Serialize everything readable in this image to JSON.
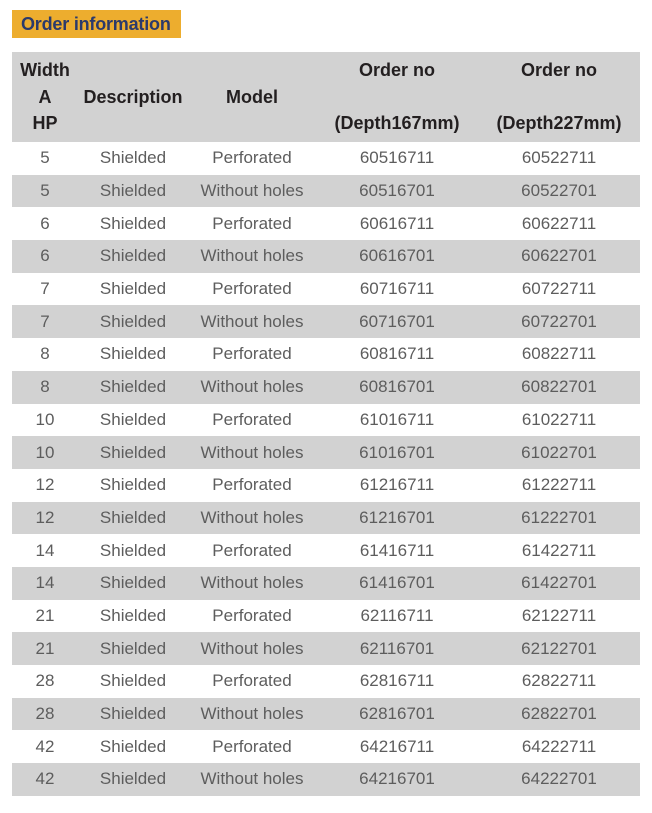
{
  "banner": {
    "title": "Order information",
    "background_color": "#edad2e",
    "text_color": "#2b3a6b"
  },
  "table": {
    "header_background_color": "#d2d2d2",
    "alt_row_background_color": "#d2d2d2",
    "row_background_color": "#ffffff",
    "header_text_color": "#231f20",
    "body_text_color": "#5d5d5d",
    "columns": [
      {
        "key": "width",
        "line1": "Width",
        "line2": "A",
        "line3": "HP",
        "type": "stack"
      },
      {
        "key": "desc",
        "line1": "Description",
        "type": "single"
      },
      {
        "key": "model",
        "line1": "Model",
        "type": "single"
      },
      {
        "key": "order1",
        "line1": "Order no",
        "line3": "(Depth167mm)",
        "type": "split"
      },
      {
        "key": "order2",
        "line1": "Order no",
        "line3": "(Depth227mm)",
        "type": "split"
      }
    ],
    "rows": [
      {
        "width": "5",
        "desc": "Shielded",
        "model": "Perforated",
        "order1": "60516711",
        "order2": "60522711"
      },
      {
        "width": "5",
        "desc": "Shielded",
        "model": "Without holes",
        "order1": "60516701",
        "order2": "60522701"
      },
      {
        "width": "6",
        "desc": "Shielded",
        "model": "Perforated",
        "order1": "60616711",
        "order2": "60622711"
      },
      {
        "width": "6",
        "desc": "Shielded",
        "model": "Without holes",
        "order1": "60616701",
        "order2": "60622701"
      },
      {
        "width": "7",
        "desc": "Shielded",
        "model": "Perforated",
        "order1": "60716711",
        "order2": "60722711"
      },
      {
        "width": "7",
        "desc": "Shielded",
        "model": "Without holes",
        "order1": "60716701",
        "order2": "60722701"
      },
      {
        "width": "8",
        "desc": "Shielded",
        "model": "Perforated",
        "order1": "60816711",
        "order2": "60822711"
      },
      {
        "width": "8",
        "desc": "Shielded",
        "model": "Without holes",
        "order1": "60816701",
        "order2": "60822701"
      },
      {
        "width": "10",
        "desc": "Shielded",
        "model": "Perforated",
        "order1": "61016711",
        "order2": "61022711"
      },
      {
        "width": "10",
        "desc": "Shielded",
        "model": "Without holes",
        "order1": "61016701",
        "order2": "61022701"
      },
      {
        "width": "12",
        "desc": "Shielded",
        "model": "Perforated",
        "order1": "61216711",
        "order2": "61222711"
      },
      {
        "width": "12",
        "desc": "Shielded",
        "model": "Without holes",
        "order1": "61216701",
        "order2": "61222701"
      },
      {
        "width": "14",
        "desc": "Shielded",
        "model": "Perforated",
        "order1": "61416711",
        "order2": "61422711"
      },
      {
        "width": "14",
        "desc": "Shielded",
        "model": "Without holes",
        "order1": "61416701",
        "order2": "61422701"
      },
      {
        "width": "21",
        "desc": "Shielded",
        "model": "Perforated",
        "order1": "62116711",
        "order2": "62122711"
      },
      {
        "width": "21",
        "desc": "Shielded",
        "model": "Without holes",
        "order1": "62116701",
        "order2": "62122701"
      },
      {
        "width": "28",
        "desc": "Shielded",
        "model": "Perforated",
        "order1": "62816711",
        "order2": "62822711"
      },
      {
        "width": "28",
        "desc": "Shielded",
        "model": "Without holes",
        "order1": "62816701",
        "order2": "62822701"
      },
      {
        "width": "42",
        "desc": "Shielded",
        "model": "Perforated",
        "order1": "64216711",
        "order2": "64222711"
      },
      {
        "width": "42",
        "desc": "Shielded",
        "model": "Without holes",
        "order1": "64216701",
        "order2": "64222701"
      }
    ]
  }
}
